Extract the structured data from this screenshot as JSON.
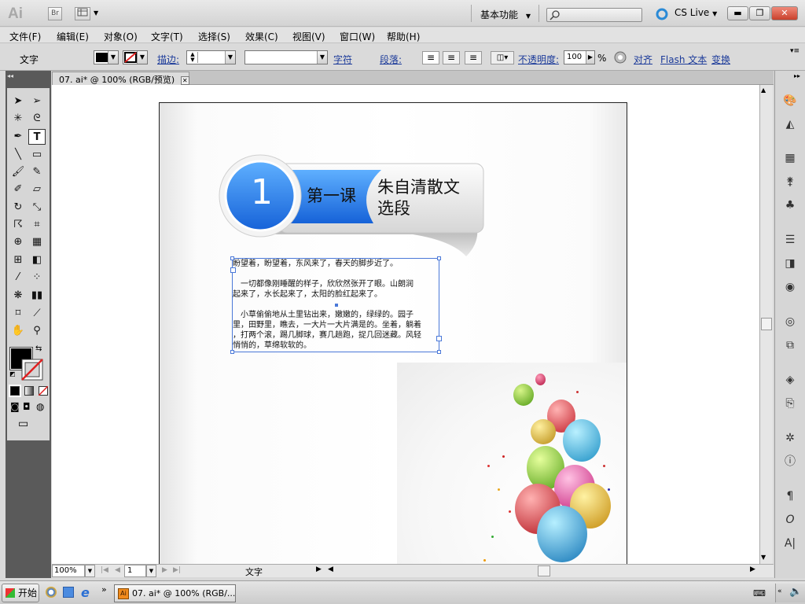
{
  "titlebar": {
    "app_logo": "Ai",
    "bridge_label": "Br",
    "workspace": "基本功能",
    "cs_live": "CS Live"
  },
  "menu": [
    "文件(F)",
    "编辑(E)",
    "对象(O)",
    "文字(T)",
    "选择(S)",
    "效果(C)",
    "视图(V)",
    "窗口(W)",
    "帮助(H)"
  ],
  "controlbar": {
    "tool_label": "文字",
    "stroke_label": "描边:",
    "character_label": "字符",
    "paragraph_label": "段落:",
    "opacity_label": "不透明度:",
    "opacity_value": "100",
    "opacity_unit": "%",
    "align_link": "对齐",
    "flash_text_link": "Flash 文本",
    "transform_link": "变换"
  },
  "document": {
    "tab_title": "07. ai* @ 100% (RGB/预览)"
  },
  "artwork": {
    "lesson_number": "1",
    "lesson_label": "第一课",
    "lesson_title_line1": "朱自清散文",
    "lesson_title_line2": "选段",
    "paragraph1": "盼望着，盼望着，东风来了，春天的脚步近了。",
    "paragraph2_line1": "　一切都像刚睡醒的样子，欣欣然张开了眼。山朗润",
    "paragraph2_line2": "起来了，水长起来了，太阳的脸红起来了。",
    "paragraph3_line1": "　小草偷偷地从土里钻出来，嫩嫩的，绿绿的。园子",
    "paragraph3_line2": "里，田野里，瞧去，一大片一大片满是的。坐着，躺着",
    "paragraph3_line3": "，打两个滚，踢几脚球，赛几趟跑，捉几回迷藏。风轻",
    "paragraph3_line4": "悄悄的，草绵软软的。"
  },
  "statusbar": {
    "zoom": "100%",
    "page": "1",
    "status": "文字"
  },
  "taskbar": {
    "start_label": "开始",
    "task_label": "07. ai* @ 100% (RGB/..."
  },
  "colors": {
    "badge_blue": "#1f6fe6",
    "tab_text_link": "#1c3b9a"
  }
}
